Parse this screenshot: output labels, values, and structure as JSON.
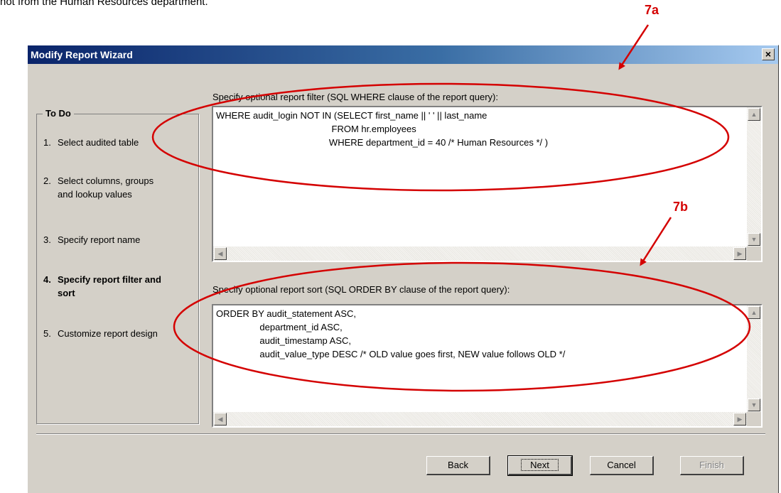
{
  "intro_text": "not from the Human Resources department.",
  "dialog": {
    "title": "Modify Report Wizard",
    "close_glyph": "×"
  },
  "todo": {
    "heading": "To Do",
    "steps": [
      {
        "num": "1.",
        "label": "Select audited table"
      },
      {
        "num": "2.",
        "label": "Select columns, groups\nand lookup values"
      },
      {
        "num": "3.",
        "label": "Specify report name"
      },
      {
        "num": "4.",
        "label": "Specify report filter and\nsort"
      },
      {
        "num": "5.",
        "label": "Customize report design"
      }
    ],
    "active_step": 4
  },
  "filter": {
    "label": "Specify optional report filter (SQL WHERE clause of the report query):",
    "value": "WHERE audit_login NOT IN (SELECT first_name || ' ' || last_name\n                                             FROM hr.employees\n                                            WHERE department_id = 40 /* Human Resources */ )"
  },
  "sort": {
    "label": "Specify optional report sort (SQL ORDER BY clause of the report query):",
    "value": "ORDER BY audit_statement ASC,\n                 department_id ASC,\n                 audit_timestamp ASC,\n                 audit_value_type DESC /* OLD value goes first, NEW value follows OLD */"
  },
  "buttons": {
    "back": "Back",
    "next": "Next",
    "cancel": "Cancel",
    "finish": "Finish"
  },
  "annotations": {
    "a": "7a",
    "b": "7b",
    "color": "#d40000"
  },
  "icons": {
    "scroll_up": "up-arrow-icon",
    "scroll_down": "down-arrow-icon",
    "scroll_left": "left-arrow-icon",
    "scroll_right": "right-arrow-icon"
  }
}
